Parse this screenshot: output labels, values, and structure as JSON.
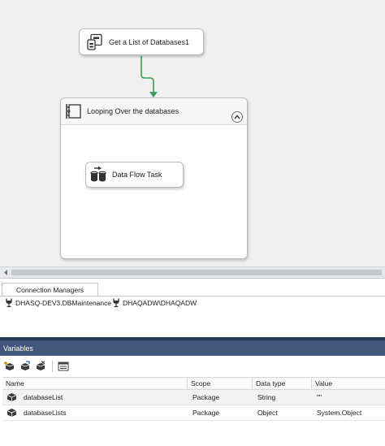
{
  "design": {
    "task1_label": "Get a List of Databases1",
    "container_label": "Looping Over the databases",
    "task2_label": "Data Flow Task"
  },
  "connection_managers": {
    "tab_label": "Connection Managers",
    "items": [
      {
        "label": "DHASQ-DEV3.DBMaintenance"
      },
      {
        "label": "DHAQADW\\DHAQADW"
      }
    ]
  },
  "variables": {
    "panel_title": "Variables",
    "columns": [
      "Name",
      "Scope",
      "Data type",
      "Value"
    ],
    "rows": [
      {
        "name": "databaseList",
        "scope": "Package",
        "type": "String",
        "value": "\"\""
      },
      {
        "name": "databaseLists",
        "scope": "Package",
        "type": "Object",
        "value": "System.Object"
      }
    ]
  },
  "colors": {
    "connector": "#3c9a5f",
    "panel_header": "#44567a",
    "panel_title_bar": "#2b3a57"
  }
}
